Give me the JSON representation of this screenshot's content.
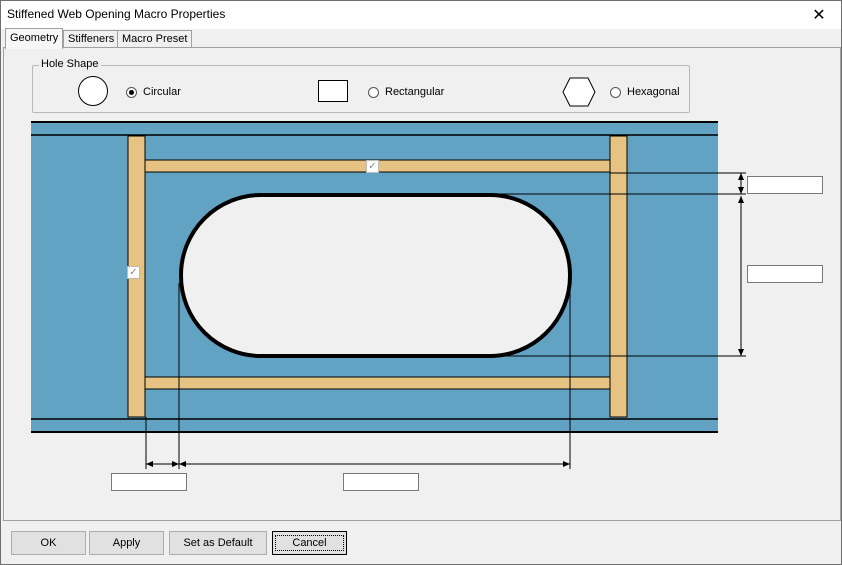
{
  "window": {
    "title": "Stiffened Web Opening Macro Properties"
  },
  "icons": {
    "close": "close-icon",
    "check": "checkmark-icon"
  },
  "tabs": [
    {
      "label": "Geometry",
      "active": true
    },
    {
      "label": "Stiffeners",
      "active": false
    },
    {
      "label": "Macro Preset",
      "active": false
    }
  ],
  "hole_shape": {
    "legend": "Hole Shape",
    "options": [
      {
        "label": "Circular",
        "icon": "circle-shape-icon",
        "selected": true
      },
      {
        "label": "Rectangular",
        "icon": "rectangle-shape-icon",
        "selected": false
      },
      {
        "label": "Hexagonal",
        "icon": "hexagon-shape-icon",
        "selected": false
      }
    ]
  },
  "diagram": {
    "colors": {
      "web": "#62a3c4",
      "stiffener": "#e6c383",
      "hole": "#f0f0f0",
      "outline": "#000000"
    },
    "horizontal_stiffeners_checkbox": {
      "checked": true
    },
    "vertical_stiffeners_checkbox": {
      "checked": true
    }
  },
  "dimensions": {
    "stiffener_offset_vertical": "",
    "hole_height": "",
    "stiffener_offset_horizontal": "",
    "hole_length": ""
  },
  "buttons": {
    "ok": "OK",
    "apply": "Apply",
    "set_default": "Set as Default",
    "cancel": "Cancel"
  }
}
